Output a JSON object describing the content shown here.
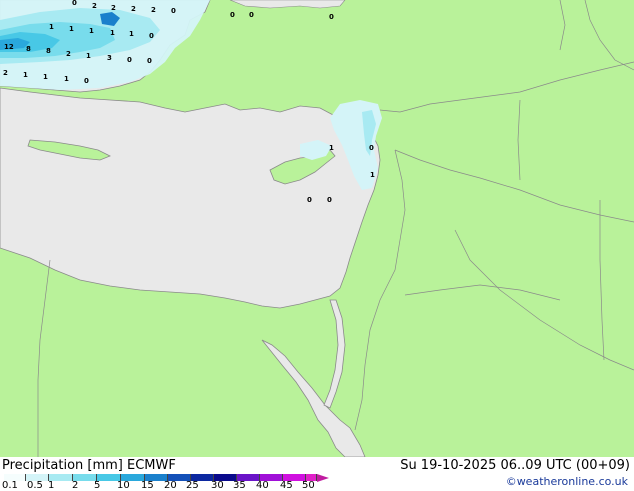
{
  "map": {
    "precip_labels": [
      {
        "text": "0",
        "pos": "left"
      },
      {
        "text": "2"
      },
      {
        "text": "2"
      },
      {
        "text": "2"
      },
      {
        "text": "2"
      },
      {
        "text": "0"
      },
      {
        "text": "0"
      },
      {
        "text": "0"
      },
      {
        "text": "0"
      },
      {
        "text": "1"
      },
      {
        "text": "1"
      },
      {
        "text": "1"
      },
      {
        "text": "1"
      },
      {
        "text": "1"
      },
      {
        "text": "0"
      },
      {
        "text": "12"
      },
      {
        "text": "8"
      },
      {
        "text": "8"
      },
      {
        "text": "2"
      },
      {
        "text": "1"
      },
      {
        "text": "3"
      },
      {
        "text": "0"
      },
      {
        "text": "0"
      },
      {
        "text": "2"
      },
      {
        "text": "1"
      },
      {
        "text": "1"
      },
      {
        "text": "1"
      },
      {
        "text": "0"
      },
      {
        "text": "1"
      },
      {
        "text": "0"
      },
      {
        "text": "1"
      },
      {
        "text": "0"
      },
      {
        "text": "0"
      }
    ]
  },
  "footer": {
    "title": "Precipitation [mm]  ECMWF",
    "datetime": "Su 19-10-2025 06..09 UTC (00+09)",
    "credit": "©weatheronline.co.uk"
  },
  "legend": {
    "ticks": [
      "0.1",
      "0.5",
      "1",
      "2",
      "5",
      "10",
      "15",
      "20",
      "25",
      "30",
      "35",
      "40",
      "45",
      "50"
    ],
    "colors": [
      "#f5fdfd",
      "#d4f4f8",
      "#a8eaf2",
      "#78dcec",
      "#48c8e6",
      "#2aa8dc",
      "#1a80cc",
      "#1450b8",
      "#0c28a0",
      "#0a0a8c",
      "#6a14c8",
      "#a010d8",
      "#d010e0",
      "#e020c8"
    ],
    "arrow_color": "#c01ca0"
  }
}
